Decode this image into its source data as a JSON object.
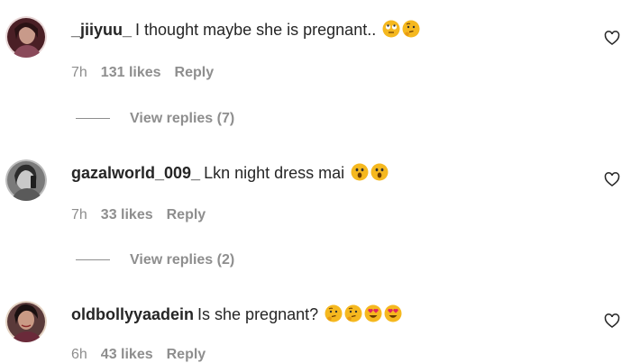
{
  "comments": [
    {
      "username": "_jiiyuu_",
      "text": "I thought maybe she is pregnant..",
      "emojis": [
        "rolling-eyes-emoji-icon",
        "thinking-emoji-icon"
      ],
      "time": "7h",
      "likes": "131 likes",
      "reply": "Reply",
      "view_replies": "View replies (7)",
      "avatar_color": "#5a2d2d"
    },
    {
      "username": "gazalworld_009_",
      "text": "Lkn night dress mai",
      "emojis": [
        "astonished-emoji-icon",
        "astonished-emoji-icon"
      ],
      "time": "7h",
      "likes": "33 likes",
      "reply": "Reply",
      "view_replies": "View replies (2)",
      "avatar_color": "#6d6d6d"
    },
    {
      "username": "oldbollyyaadein",
      "text": "Is she pregnant?",
      "emojis": [
        "thinking-emoji-icon",
        "thinking-emoji-icon",
        "heart-eyes-emoji-icon",
        "heart-eyes-emoji-icon"
      ],
      "time": "6h",
      "likes": "43 likes",
      "reply": "Reply",
      "avatar_color": "#3a2a2a"
    }
  ],
  "colors": {
    "text": "#262626",
    "muted": "#8e8e8e",
    "emoji_yellow": "#f5b81f"
  }
}
